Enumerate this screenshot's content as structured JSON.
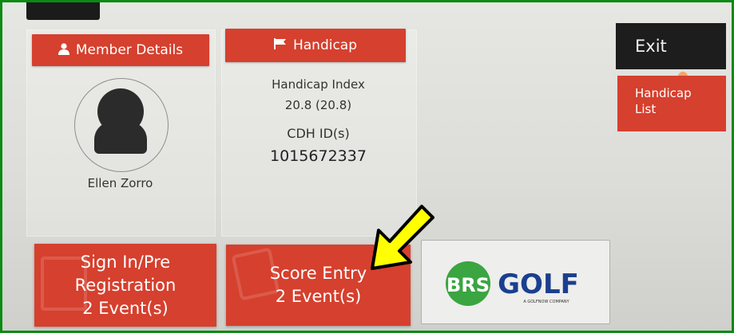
{
  "member": {
    "header_label": "Member Details",
    "header_icon": "person-icon",
    "name": "Ellen Zorro"
  },
  "handicap": {
    "header_label": "Handicap",
    "header_icon": "flag-icon",
    "index_label": "Handicap Index",
    "index_value": "20.8 (20.8)",
    "cdh_label": "CDH ID(s)",
    "cdh_value": "1015672337"
  },
  "actions": {
    "exit_label": "Exit",
    "handicap_list_line1": "Handicap",
    "handicap_list_line2": "List"
  },
  "tiles": {
    "signin_line1": "Sign In/Pre",
    "signin_line2": "Registration",
    "signin_line3": "2 Event(s)",
    "score_line1": "Score Entry",
    "score_line2": "2 Event(s)"
  },
  "logo": {
    "brs": "BRS",
    "golf": "GOLF",
    "tagline": "A GOLFNOW COMPANY"
  },
  "colors": {
    "accent_red": "#d6402e",
    "frame_green": "#0a8a12",
    "exit_black": "#1d1d1d",
    "arrow_yellow": "#ffff00"
  }
}
